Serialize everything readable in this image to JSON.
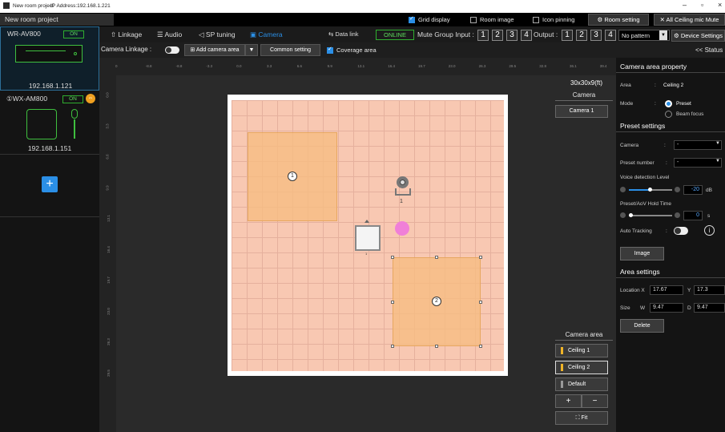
{
  "window": {
    "title": "New room project",
    "ip": "IP Address:192.168.1.221",
    "minimize": "–",
    "restore": "▫",
    "close": "×"
  },
  "project": {
    "name": "New room project",
    "grid_display": "Grid display",
    "room_image": "Room image",
    "icon_pinning": "Icon pinning",
    "room_setting": "Room setting",
    "all_ceiling_mute": "All Ceiling mic Mute"
  },
  "devices": [
    {
      "name": "WR-AV800",
      "status": "ON",
      "ip": "192.168.1.121"
    },
    {
      "name": "①WX-AM800",
      "status": "ON",
      "ip": "192.168.1.151"
    }
  ],
  "tabs": {
    "linkage": "Linkage",
    "audio": "Audio",
    "sp_tuning": "SP tuning",
    "camera": "Camera"
  },
  "header": {
    "data_link": "Data link",
    "online": "ONLINE",
    "mute_group_label": "Mute Group Input :",
    "mute_inputs": [
      "1",
      "2",
      "3",
      "4"
    ],
    "output_label": "Output :",
    "outputs": [
      "1",
      "2",
      "3",
      "4"
    ],
    "pattern": "No pattern",
    "device_settings": "Device Settings",
    "status": "<< Status"
  },
  "toolbar": {
    "camera_linkage": "Camera Linkage :",
    "add_camera_area": "Add camera area",
    "common_setting": "Common setting",
    "coverage_area": "Coverage area"
  },
  "ruler": {
    "top": [
      "0",
      "-8.8",
      "-8.8",
      "-3.3",
      "0.0",
      "3.3",
      "6.6",
      "9.9",
      "13.1",
      "16.4",
      "19.7",
      "23.0",
      "26.3",
      "29.5",
      "32.8",
      "36.1",
      "39.4"
    ],
    "left": [
      "0.0",
      "3.3",
      "6.6",
      "9.9",
      "13.1",
      "16.4",
      "19.7",
      "23.0",
      "26.3",
      "29.5"
    ]
  },
  "canvas": {
    "room_size": "30x30x9(ft)",
    "camera_header": "Camera",
    "camera_btn": "Camera 1",
    "area1_num": "1",
    "area2_num": "2",
    "camera_icon_label": "1",
    "mic_label": "1",
    "camera_area_header": "Camera area",
    "areas": [
      "Ceiling 1",
      "Ceiling 2",
      "Default"
    ],
    "plus": "+",
    "minus": "−",
    "fit": "Fit"
  },
  "property": {
    "title": "Camera area property",
    "area_label": "Area",
    "area_value": "Ceiling 2",
    "mode_label": "Mode",
    "mode_preset": "Preset",
    "mode_beam": "Beam focus",
    "preset_settings": "Preset settings",
    "camera_label": "Camera",
    "camera_value": "-",
    "preset_number_label": "Preset number",
    "preset_number_value": "-",
    "voice_level_label": "Voice detection Level",
    "voice_level_value": "-20",
    "voice_level_unit": "dB",
    "hold_time_label": "Preset/AoV Hold Time",
    "hold_time_value": "0",
    "hold_time_unit": "s",
    "auto_tracking_label": "Auto Tracking",
    "image_btn": "Image",
    "area_settings": "Area settings",
    "loc_x_label": "Location X",
    "loc_x": "17.67",
    "loc_y_label": "Y",
    "loc_y": "17.3",
    "size_label": "Size",
    "size_w_label": "W",
    "size_w": "9.47",
    "size_d_label": "D",
    "size_d": "9.47",
    "delete_btn": "Delete"
  }
}
